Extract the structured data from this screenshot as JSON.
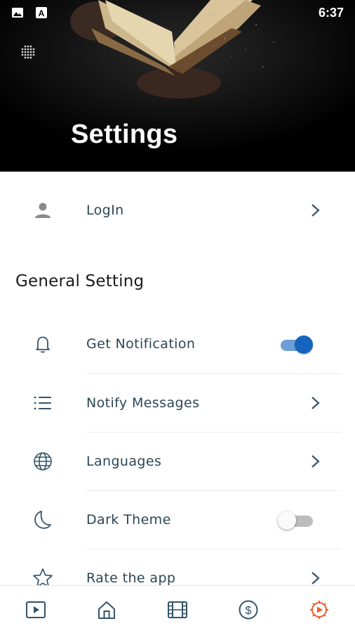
{
  "status_bar": {
    "time": "6:37",
    "icons": [
      "image-icon",
      "text-a-icon"
    ]
  },
  "header": {
    "title": "Settings",
    "menu_icon": "dots-grid-icon"
  },
  "login": {
    "label": "LogIn",
    "icon": "person-icon"
  },
  "general": {
    "title": "General Setting",
    "items": [
      {
        "label": "Get Notification",
        "icon": "bell-icon",
        "control": "toggle",
        "on": true
      },
      {
        "label": "Notify Messages",
        "icon": "list-icon",
        "control": "chevron"
      },
      {
        "label": "Languages",
        "icon": "globe-icon",
        "control": "chevron"
      },
      {
        "label": "Dark Theme",
        "icon": "moon-icon",
        "control": "toggle",
        "on": false
      },
      {
        "label": "Rate the app",
        "icon": "star-icon",
        "control": "chevron"
      }
    ]
  },
  "bottom_nav": {
    "items": [
      {
        "icon": "play-video-icon",
        "active": false
      },
      {
        "icon": "home-icon",
        "active": false
      },
      {
        "icon": "film-icon",
        "active": false
      },
      {
        "icon": "dollar-coin-icon",
        "active": false
      },
      {
        "icon": "settings-gear-icon",
        "active": true
      }
    ]
  },
  "colors": {
    "accent_active": "#ef5b2a",
    "icon_default": "#34546a",
    "toggle_on": "#1565c0",
    "header_bg": "#000000"
  }
}
